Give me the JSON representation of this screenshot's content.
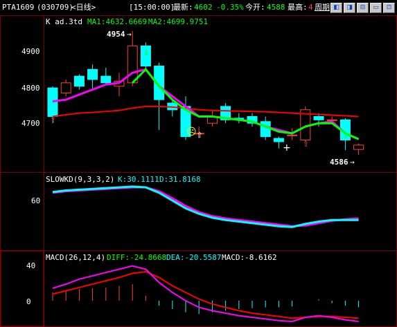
{
  "header": {
    "symbol": "PTA1609",
    "code": "(030709)",
    "period": "<日线>",
    "time": "[15:00:00]",
    "latest_label": "最新:",
    "latest_value": "4602",
    "change": "-0.35%",
    "open_label": "今开:",
    "open_value": "4588",
    "high_label": "最高:",
    "high_value": "4",
    "cycle_button": "周期"
  },
  "window_buttons": [
    "◧",
    "◨",
    "⊟",
    "▭",
    "⊡"
  ],
  "colors": {
    "up": "#ff4040",
    "down": "#00ffff",
    "ma1": "#ff00ff",
    "ma2": "#00ff00",
    "ma3": "#ff0000",
    "grid": "#7a0000",
    "label": "#ffffff"
  },
  "main_panel": {
    "title": "K  ad.3td",
    "ma1_label": "MA1:4632.6669",
    "ma2_label": "MA2:4699.9751",
    "y_ticks": [
      "4900",
      "4800",
      "4700"
    ],
    "high_marker": "4954",
    "low_marker": "4586"
  },
  "kd_panel": {
    "title": "SLOWKD(9,3,3,2)",
    "k_label": "K:30.1111",
    "d_label": "D:31.8168",
    "y_ticks": [
      "60"
    ]
  },
  "macd_panel": {
    "title": "MACD(26,12,4)",
    "diff_label": "DIFF:-24.8668",
    "dea_label": "DEA:-20.5587",
    "macd_label": "MACD:-8.6162",
    "y_ticks": [
      "40",
      "0"
    ]
  },
  "chart_data": {
    "type": "candlestick",
    "y_range": [
      4590,
      4960
    ],
    "candles": [
      {
        "o": 4785,
        "c": 4700,
        "h": 4790,
        "l": 4680
      },
      {
        "o": 4770,
        "c": 4800,
        "h": 4810,
        "l": 4760
      },
      {
        "o": 4820,
        "c": 4790,
        "h": 4825,
        "l": 4780
      },
      {
        "o": 4840,
        "c": 4810,
        "h": 4855,
        "l": 4780
      },
      {
        "o": 4820,
        "c": 4800,
        "h": 4845,
        "l": 4795
      },
      {
        "o": 4790,
        "c": 4805,
        "h": 4830,
        "l": 4760
      },
      {
        "o": 4800,
        "c": 4910,
        "h": 4954,
        "l": 4790
      },
      {
        "o": 4910,
        "c": 4850,
        "h": 4920,
        "l": 4840
      },
      {
        "o": 4850,
        "c": 4750,
        "h": 4860,
        "l": 4660
      },
      {
        "o": 4740,
        "c": 4720,
        "h": 4750,
        "l": 4700
      },
      {
        "o": 4730,
        "c": 4640,
        "h": 4760,
        "l": 4630
      },
      {
        "o": 4650,
        "c": 4650,
        "h": 4670,
        "l": 4635
      },
      {
        "o": 4680,
        "c": 4700,
        "h": 4720,
        "l": 4670
      },
      {
        "o": 4730,
        "c": 4690,
        "h": 4740,
        "l": 4680
      },
      {
        "o": 4695,
        "c": 4690,
        "h": 4710,
        "l": 4680
      },
      {
        "o": 4700,
        "c": 4680,
        "h": 4710,
        "l": 4670
      },
      {
        "o": 4685,
        "c": 4640,
        "h": 4700,
        "l": 4630
      },
      {
        "o": 4635,
        "c": 4625,
        "h": 4640,
        "l": 4605
      },
      {
        "o": 4645,
        "c": 4645,
        "h": 4665,
        "l": 4630
      },
      {
        "o": 4630,
        "c": 4720,
        "h": 4730,
        "l": 4625
      },
      {
        "o": 4700,
        "c": 4690,
        "h": 4710,
        "l": 4670
      },
      {
        "o": 4690,
        "c": 4690,
        "h": 4700,
        "l": 4680
      },
      {
        "o": 4690,
        "c": 4630,
        "h": 4695,
        "l": 4600
      },
      {
        "o": 4602,
        "c": 4615,
        "h": 4620,
        "l": 4586
      }
    ],
    "ma1": [
      4745,
      4750,
      4765,
      4780,
      4795,
      4800,
      4830,
      4840,
      4790,
      4760,
      4730,
      4700,
      4700,
      4695,
      4690,
      4685,
      4670,
      4660,
      4650,
      4670,
      4680,
      4685,
      4650,
      4632
    ],
    "ma2": [
      null,
      null,
      null,
      null,
      null,
      null,
      4800,
      4840,
      4790,
      4750,
      4720,
      4700,
      4700,
      4695,
      4690,
      4685,
      4670,
      4655,
      4650,
      4670,
      4680,
      4680,
      4650,
      4633
    ],
    "ma3": [
      4700,
      4705,
      4710,
      4712,
      4715,
      4718,
      4725,
      4730,
      4730,
      4728,
      4725,
      4720,
      4718,
      4717,
      4716,
      4715,
      4714,
      4712,
      4710,
      4708,
      4706,
      4704,
      4702,
      4700
    ],
    "kd_k": [
      66,
      68,
      69,
      70,
      71,
      72,
      73,
      72,
      65,
      55,
      45,
      38,
      33,
      30,
      28,
      26,
      24,
      22,
      21,
      25,
      28,
      30,
      30,
      30
    ],
    "kd_d": [
      65,
      67,
      68,
      69,
      70,
      71,
      72,
      72,
      67,
      58,
      48,
      40,
      35,
      32,
      30,
      28,
      26,
      24,
      22,
      23,
      26,
      29,
      31,
      32
    ],
    "macd_diff": [
      15,
      20,
      26,
      30,
      34,
      38,
      42,
      38,
      22,
      10,
      0,
      -8,
      -12,
      -15,
      -18,
      -20,
      -22,
      -24,
      -25,
      -20,
      -18,
      -20,
      -23,
      -25
    ],
    "macd_dea": [
      8,
      12,
      16,
      20,
      24,
      28,
      33,
      35,
      28,
      18,
      10,
      2,
      -4,
      -8,
      -12,
      -15,
      -17,
      -19,
      -21,
      -20,
      -19,
      -19,
      -20,
      -21
    ],
    "macd_bar": [
      10,
      12,
      14,
      15,
      16,
      18,
      20,
      6,
      -6,
      -10,
      -14,
      -16,
      -14,
      -12,
      -10,
      -9,
      -8,
      -8,
      -7,
      0,
      2,
      -3,
      -6,
      -8
    ]
  }
}
